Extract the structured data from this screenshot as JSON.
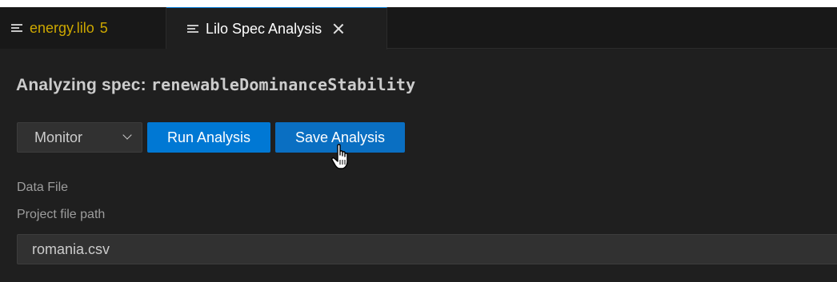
{
  "tabs": [
    {
      "label": "energy.lilo",
      "count": "5",
      "color": "#cca700"
    },
    {
      "label": "Lilo Spec Analysis",
      "active": true
    }
  ],
  "heading": {
    "prefix": "Analyzing spec: ",
    "spec_name": "renewableDominanceStability"
  },
  "toolbar": {
    "mode_select": {
      "value": "Monitor"
    },
    "run_label": "Run Analysis",
    "save_label": "Save Analysis"
  },
  "form": {
    "data_file_label": "Data File",
    "path_label": "Project file path",
    "path_value": "romania.csv"
  },
  "colors": {
    "accent": "#0078d4",
    "background": "#1f1f1f",
    "tab_warning": "#cca700"
  }
}
